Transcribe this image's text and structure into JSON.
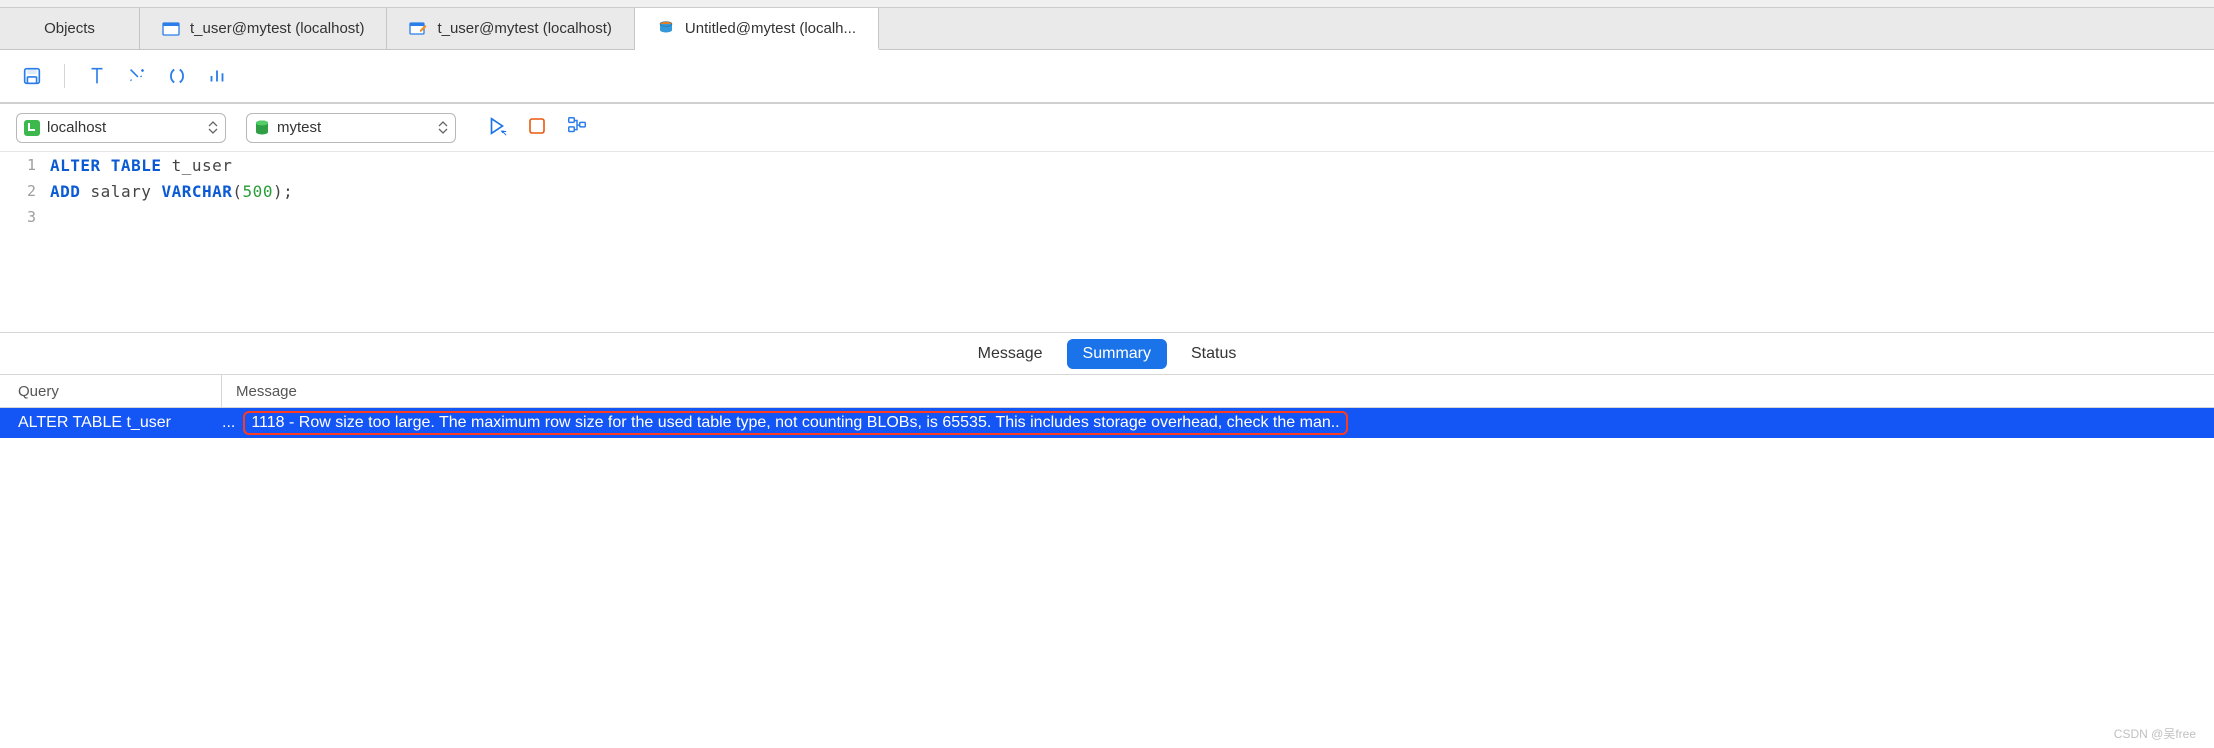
{
  "tabs": [
    {
      "label": "Objects",
      "icon": null
    },
    {
      "label": "t_user@mytest (localhost)",
      "icon": "table-icon"
    },
    {
      "label": "t_user@mytest (localhost)",
      "icon": "table-edit-icon"
    },
    {
      "label": "Untitled@mytest (localh...",
      "icon": "query-icon",
      "active": true
    }
  ],
  "connection_combo": {
    "value": "localhost",
    "icon_color": "#3db84c"
  },
  "database_combo": {
    "value": "mytest",
    "icon_color": "#2f9e44"
  },
  "sql": {
    "lines": [
      {
        "n": "1",
        "tokens": [
          {
            "t": "ALTER TABLE",
            "c": "kw"
          },
          {
            "t": " t_user",
            "c": "plain"
          }
        ]
      },
      {
        "n": "2",
        "tokens": [
          {
            "t": "ADD",
            "c": "kw"
          },
          {
            "t": " salary ",
            "c": "plain"
          },
          {
            "t": "VARCHAR",
            "c": "type"
          },
          {
            "t": "(",
            "c": "plain"
          },
          {
            "t": "500",
            "c": "num"
          },
          {
            "t": ");",
            "c": "plain"
          }
        ]
      },
      {
        "n": "3",
        "tokens": []
      }
    ]
  },
  "results_tabs": [
    {
      "label": "Message",
      "active": false
    },
    {
      "label": "Summary",
      "active": true
    },
    {
      "label": "Status",
      "active": false
    }
  ],
  "results_header": {
    "query": "Query",
    "message": "Message"
  },
  "results_row": {
    "query": "ALTER TABLE t_user",
    "ellipsis": "...",
    "message": "1118 - Row size too large. The maximum row size for the used table type, not counting BLOBs, is 65535. This includes storage overhead, check the man.."
  },
  "watermark": "CSDN @吴free"
}
